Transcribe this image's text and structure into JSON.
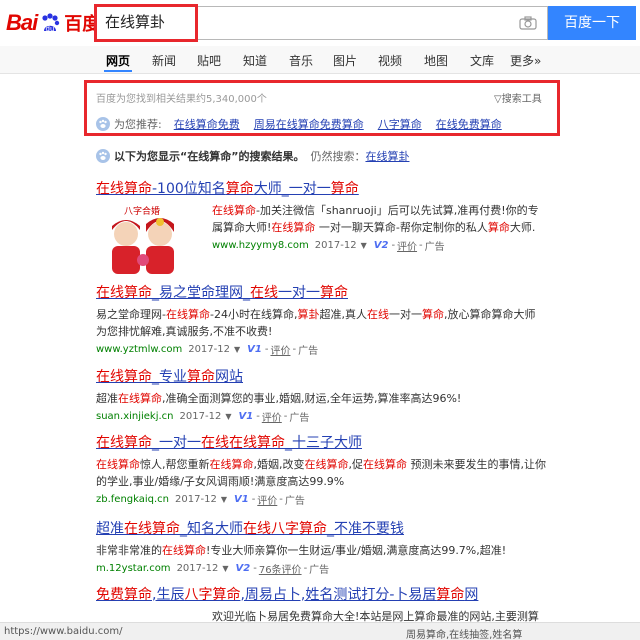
{
  "logo": {
    "bai": "Bai",
    "du": "百度"
  },
  "search": {
    "query": "在线算卦",
    "button": "百度一下"
  },
  "nav": {
    "tabs": [
      "网页",
      "新闻",
      "贴吧",
      "知道",
      "音乐",
      "图片",
      "视频",
      "地图",
      "文库",
      "更多»"
    ],
    "active": "网页"
  },
  "stats": {
    "text": "百度为您找到相关结果约5,340,000个",
    "tools": "搜索工具"
  },
  "recommend": {
    "label": "为您推荐:",
    "links": [
      "在线算命免费",
      "周易在线算命免费算命",
      "八字算命",
      "在线免费算命"
    ]
  },
  "notice": {
    "prefix": "以下为您显示“",
    "keyword": "在线算命",
    "suffix": "”的搜索结果。",
    "still": "仍然搜索：",
    "original": "在线算卦"
  },
  "results": [
    {
      "title_parts": [
        [
          "在线算命",
          true
        ],
        [
          "-100位知名",
          false
        ],
        [
          "算命",
          true
        ],
        [
          "大师_一对一",
          false
        ],
        [
          "算命",
          true
        ]
      ],
      "desc_parts": [
        [
          "在线算命",
          true
        ],
        [
          "-加关注微信「shanruoji」后可以先试算,准再付费!你的专属算命大师!",
          false
        ],
        [
          "在线算命",
          true
        ],
        [
          " 一对一聊天算命-帮你定制你的私人",
          false
        ],
        [
          "算命",
          true
        ],
        [
          "大师.",
          false
        ]
      ],
      "url": "www.hzyymy8.com",
      "date": "2017-12",
      "v": "V2",
      "review": "评价",
      "ad": "广告",
      "thumb_text": "八字合婚"
    },
    {
      "title_parts": [
        [
          "在线算命",
          true
        ],
        [
          "_易之堂命理网_",
          false
        ],
        [
          "在线",
          true
        ],
        [
          "一对一",
          false
        ],
        [
          "算命",
          true
        ]
      ],
      "desc_parts": [
        [
          "易之堂命理网-",
          false
        ],
        [
          "在线算命",
          true
        ],
        [
          "-24小时在线算命,",
          false
        ],
        [
          "算卦",
          true
        ],
        [
          "超准,真人",
          false
        ],
        [
          "在线",
          true
        ],
        [
          "一对一",
          false
        ],
        [
          "算命",
          true
        ],
        [
          ",放心算命算命大师为您排忧解难,真诚服务,不准不收费!",
          false
        ]
      ],
      "url": "www.yztmlw.com",
      "date": "2017-12",
      "v": "V1",
      "review": "评价",
      "ad": "广告"
    },
    {
      "title_parts": [
        [
          "在线算命",
          true
        ],
        [
          "_专业",
          false
        ],
        [
          "算命",
          true
        ],
        [
          "网站",
          false
        ]
      ],
      "desc_parts": [
        [
          "超准",
          false
        ],
        [
          "在线算命",
          true
        ],
        [
          ",准确全面测算您的事业,婚姻,财运,全年运势,算准率高达96%!",
          false
        ]
      ],
      "url": "suan.xinjiekj.cn",
      "date": "2017-12",
      "v": "V1",
      "review": "评价",
      "ad": "广告"
    },
    {
      "title_parts": [
        [
          "在线算命",
          true
        ],
        [
          "_一对一",
          false
        ],
        [
          "在线在线算命",
          true
        ],
        [
          "_十三子大师",
          false
        ]
      ],
      "desc_parts": [
        [
          "在线算命",
          true
        ],
        [
          "惊人,帮您重新",
          false
        ],
        [
          "在线算命",
          true
        ],
        [
          ",婚姻,改变",
          false
        ],
        [
          "在线算命",
          true
        ],
        [
          ",促",
          false
        ],
        [
          "在线算命",
          true
        ],
        [
          " 预测未来要发生的事情,让你的学业,事业/婚缘/子女风调雨顺!满意度高达99.9%",
          false
        ]
      ],
      "url": "zb.fengkaiq.cn",
      "date": "2017-12",
      "v": "V1",
      "review": "评价",
      "ad": "广告"
    },
    {
      "title_parts": [
        [
          "超准",
          false
        ],
        [
          "在线算命",
          true
        ],
        [
          "_知名大师",
          false
        ],
        [
          "在线八字算命",
          true
        ],
        [
          "_不准不要钱",
          false
        ]
      ],
      "desc_parts": [
        [
          "非常非常准的",
          false
        ],
        [
          "在线算命",
          true
        ],
        [
          "!专业大师亲算你一生财运/事业/婚姻,满意度高达99.7%,超准!",
          false
        ]
      ],
      "url": "m.12ystar.com",
      "date": "2017-12",
      "v": "V2",
      "review": "76条评价",
      "ad": "广告"
    },
    {
      "title_parts": [
        [
          "免费算命",
          true
        ],
        [
          ",生辰",
          false
        ],
        [
          "八字算命",
          true
        ],
        [
          ",周易占卜,姓名测试打分-卜易居",
          false
        ],
        [
          "算命",
          true
        ],
        [
          "网",
          false
        ]
      ],
      "desc_parts": [
        [
          "欢迎光临卜易居免费算命大全!本站是网上算命最准的网站,主要测算",
          false
        ]
      ],
      "url": "",
      "date": "",
      "v": "",
      "review": "",
      "ad": ""
    }
  ],
  "statusbar": {
    "url": "https://www.baidu.com/",
    "right": "周易算命,在线抽签,姓名算"
  }
}
